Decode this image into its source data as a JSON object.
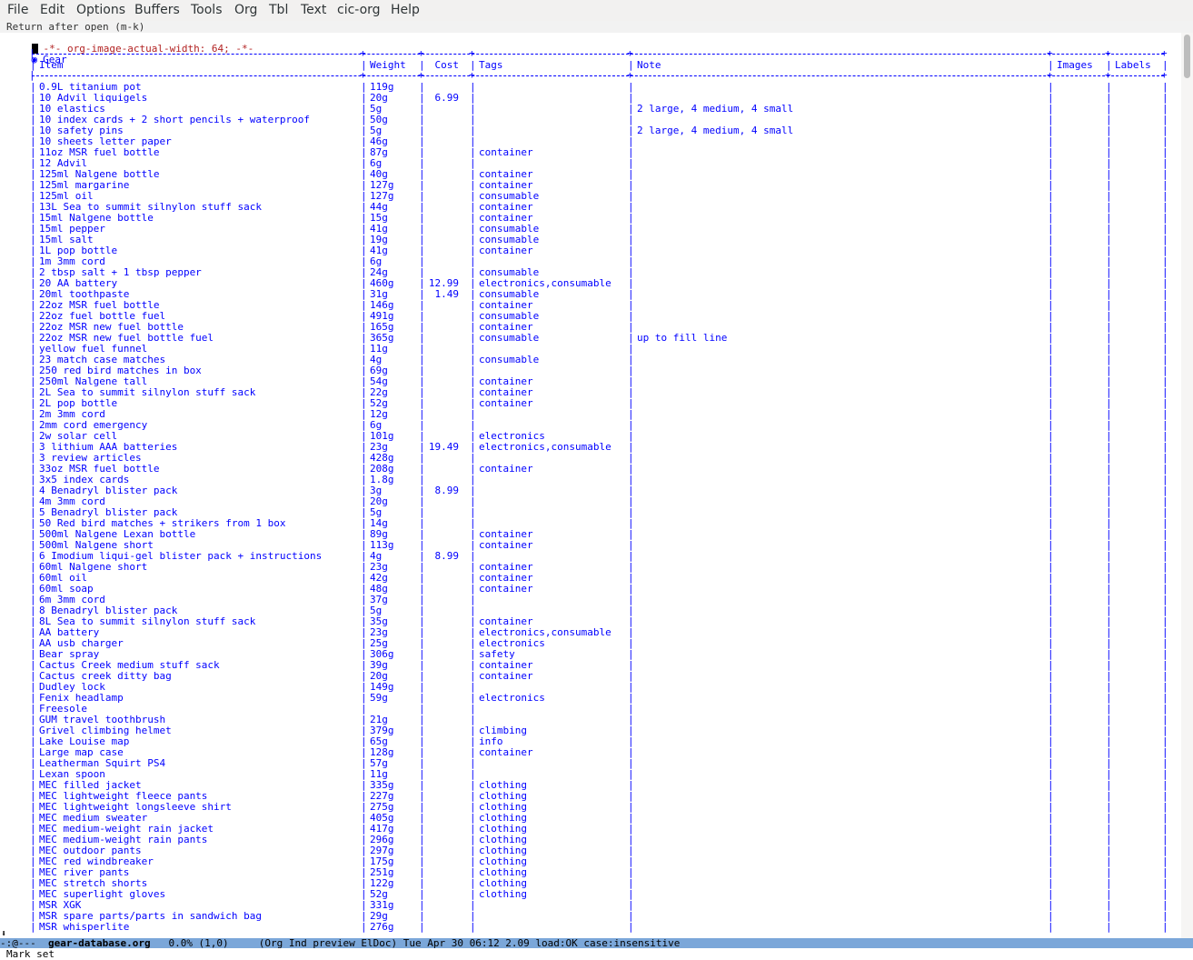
{
  "menu": [
    "File",
    "Edit",
    "Options",
    "Buffers",
    "Tools",
    "Org",
    "Tbl",
    "Text",
    "cic-org",
    "Help"
  ],
  "header_line": "Return after open (m-k)",
  "property_line": "-*- org-image-actual-width: 64; -*-",
  "heading": {
    "bullet": "◉",
    "title": "Gear"
  },
  "table": {
    "headers": [
      "Item",
      "Weight",
      "Cost",
      "Tags",
      "Note",
      "Images",
      "Labels"
    ],
    "rows": [
      [
        "0.9L titanium pot",
        "119g",
        "",
        "",
        "",
        "",
        ""
      ],
      [
        "10 Advil liquigels",
        "20g",
        "6.99",
        "",
        "",
        "",
        ""
      ],
      [
        "10 elastics",
        "5g",
        "",
        "",
        "2 large, 4 medium, 4 small",
        "",
        ""
      ],
      [
        "10 index cards + 2 short pencils + waterproof",
        "50g",
        "",
        "",
        "",
        "",
        ""
      ],
      [
        "10 safety pins",
        "5g",
        "",
        "",
        "2 large, 4 medium, 4 small",
        "",
        ""
      ],
      [
        "10 sheets letter paper",
        "46g",
        "",
        "",
        "",
        "",
        ""
      ],
      [
        "11oz MSR fuel bottle",
        "87g",
        "",
        "container",
        "",
        "",
        ""
      ],
      [
        "12 Advil",
        "6g",
        "",
        "",
        "",
        "",
        ""
      ],
      [
        "125ml Nalgene bottle",
        "40g",
        "",
        "container",
        "",
        "",
        ""
      ],
      [
        "125ml margarine",
        "127g",
        "",
        "container",
        "",
        "",
        ""
      ],
      [
        "125ml oil",
        "127g",
        "",
        "consumable",
        "",
        "",
        ""
      ],
      [
        "13L Sea to summit silnylon stuff sack",
        "44g",
        "",
        "container",
        "",
        "",
        ""
      ],
      [
        "15ml Nalgene bottle",
        "15g",
        "",
        "container",
        "",
        "",
        ""
      ],
      [
        "15ml pepper",
        "41g",
        "",
        "consumable",
        "",
        "",
        ""
      ],
      [
        "15ml salt",
        "19g",
        "",
        "consumable",
        "",
        "",
        ""
      ],
      [
        "1L pop bottle",
        "41g",
        "",
        "container",
        "",
        "",
        ""
      ],
      [
        "1m 3mm cord",
        "6g",
        "",
        "",
        "",
        "",
        ""
      ],
      [
        "2 tbsp salt + 1 tbsp pepper",
        "24g",
        "",
        "consumable",
        "",
        "",
        ""
      ],
      [
        "20 AA battery",
        "460g",
        "12.99",
        "electronics,consumable",
        "",
        "",
        ""
      ],
      [
        "20ml toothpaste",
        "31g",
        "1.49",
        "consumable",
        "",
        "",
        ""
      ],
      [
        "22oz MSR fuel bottle",
        "146g",
        "",
        "container",
        "",
        "",
        ""
      ],
      [
        "22oz fuel bottle fuel",
        "491g",
        "",
        "consumable",
        "",
        "",
        ""
      ],
      [
        "22oz MSR new fuel bottle",
        "165g",
        "",
        "container",
        "",
        "",
        ""
      ],
      [
        "22oz MSR new fuel bottle fuel",
        "365g",
        "",
        "consumable",
        "up to fill line",
        "",
        ""
      ],
      [
        "yellow fuel funnel",
        "11g",
        "",
        "",
        "",
        "",
        ""
      ],
      [
        "23 match case matches",
        "4g",
        "",
        "consumable",
        "",
        "",
        ""
      ],
      [
        "250 red bird matches in box",
        "69g",
        "",
        "",
        "",
        "",
        ""
      ],
      [
        "250ml Nalgene tall",
        "54g",
        "",
        "container",
        "",
        "",
        ""
      ],
      [
        "2L Sea to summit silnylon stuff sack",
        "22g",
        "",
        "container",
        "",
        "",
        ""
      ],
      [
        "2L pop bottle",
        "52g",
        "",
        "container",
        "",
        "",
        ""
      ],
      [
        "2m 3mm cord",
        "12g",
        "",
        "",
        "",
        "",
        ""
      ],
      [
        "2mm cord emergency",
        "6g",
        "",
        "",
        "",
        "",
        ""
      ],
      [
        "2w solar cell",
        "101g",
        "",
        "electronics",
        "",
        "",
        ""
      ],
      [
        "3 lithium AAA batteries",
        "23g",
        "19.49",
        "electronics,consumable",
        "",
        "",
        ""
      ],
      [
        "3 review articles",
        "428g",
        "",
        "",
        "",
        "",
        ""
      ],
      [
        "33oz MSR fuel bottle",
        "208g",
        "",
        "container",
        "",
        "",
        ""
      ],
      [
        "3x5 index cards",
        "1.8g",
        "",
        "",
        "",
        "",
        ""
      ],
      [
        "4 Benadryl blister pack",
        "3g",
        "8.99",
        "",
        "",
        "",
        ""
      ],
      [
        "4m 3mm cord",
        "20g",
        "",
        "",
        "",
        "",
        ""
      ],
      [
        "5 Benadryl blister pack",
        "5g",
        "",
        "",
        "",
        "",
        ""
      ],
      [
        "50 Red bird matches + strikers from 1 box",
        "14g",
        "",
        "",
        "",
        "",
        ""
      ],
      [
        "500ml Nalgene Lexan bottle",
        "89g",
        "",
        "container",
        "",
        "",
        ""
      ],
      [
        "500ml Nalgene short",
        "113g",
        "",
        "container",
        "",
        "",
        ""
      ],
      [
        "6 Imodium liqui-gel blister pack + instructions",
        "4g",
        "8.99",
        "",
        "",
        "",
        ""
      ],
      [
        "60ml Nalgene short",
        "23g",
        "",
        "container",
        "",
        "",
        ""
      ],
      [
        "60ml oil",
        "42g",
        "",
        "container",
        "",
        "",
        ""
      ],
      [
        "60ml soap",
        "48g",
        "",
        "container",
        "",
        "",
        ""
      ],
      [
        "6m 3mm cord",
        "37g",
        "",
        "",
        "",
        "",
        ""
      ],
      [
        "8 Benadryl blister pack",
        "5g",
        "",
        "",
        "",
        "",
        ""
      ],
      [
        "8L Sea to summit silnylon stuff sack",
        "35g",
        "",
        "container",
        "",
        "",
        ""
      ],
      [
        "AA battery",
        "23g",
        "",
        "electronics,consumable",
        "",
        "",
        ""
      ],
      [
        "AA usb charger",
        "25g",
        "",
        "electronics",
        "",
        "",
        ""
      ],
      [
        "Bear spray",
        "306g",
        "",
        "safety",
        "",
        "",
        ""
      ],
      [
        "Cactus Creek medium stuff sack",
        "39g",
        "",
        "container",
        "",
        "",
        ""
      ],
      [
        "Cactus creek ditty bag",
        "20g",
        "",
        "container",
        "",
        "",
        ""
      ],
      [
        "Dudley lock",
        "149g",
        "",
        "",
        "",
        "",
        ""
      ],
      [
        "Fenix headlamp",
        "59g",
        "",
        "electronics",
        "",
        "",
        ""
      ],
      [
        "Freesole",
        "",
        "",
        "",
        "",
        "",
        ""
      ],
      [
        "GUM travel toothbrush",
        "21g",
        "",
        "",
        "",
        "",
        ""
      ],
      [
        "Grivel climbing helmet",
        "379g",
        "",
        "climbing",
        "",
        "",
        ""
      ],
      [
        "Lake Louise map",
        "65g",
        "",
        "info",
        "",
        "",
        ""
      ],
      [
        "Large map case",
        "128g",
        "",
        "container",
        "",
        "",
        ""
      ],
      [
        "Leatherman Squirt PS4",
        "57g",
        "",
        "",
        "",
        "",
        ""
      ],
      [
        "Lexan spoon",
        "11g",
        "",
        "",
        "",
        "",
        ""
      ],
      [
        "MEC filled jacket",
        "335g",
        "",
        "clothing",
        "",
        "",
        ""
      ],
      [
        "MEC lightweight fleece pants",
        "227g",
        "",
        "clothing",
        "",
        "",
        ""
      ],
      [
        "MEC lightweight longsleeve shirt",
        "275g",
        "",
        "clothing",
        "",
        "",
        ""
      ],
      [
        "MEC medium sweater",
        "405g",
        "",
        "clothing",
        "",
        "",
        ""
      ],
      [
        "MEC medium-weight rain jacket",
        "417g",
        "",
        "clothing",
        "",
        "",
        ""
      ],
      [
        "MEC medium-weight rain pants",
        "296g",
        "",
        "clothing",
        "",
        "",
        ""
      ],
      [
        "MEC outdoor pants",
        "297g",
        "",
        "clothing",
        "",
        "",
        ""
      ],
      [
        "MEC red windbreaker",
        "175g",
        "",
        "clothing",
        "",
        "",
        ""
      ],
      [
        "MEC river pants",
        "251g",
        "",
        "clothing",
        "",
        "",
        ""
      ],
      [
        "MEC stretch shorts",
        "122g",
        "",
        "clothing",
        "",
        "",
        ""
      ],
      [
        "MEC superlight gloves",
        "52g",
        "",
        "clothing",
        "",
        "",
        ""
      ],
      [
        "MSR XGK",
        "331g",
        "",
        "",
        "",
        "",
        ""
      ],
      [
        "MSR spare parts/parts in sandwich bag",
        "29g",
        "",
        "",
        "",
        "",
        ""
      ],
      [
        "MSR whisperlite",
        "276g",
        "",
        "",
        "",
        "",
        ""
      ]
    ]
  },
  "modeline": {
    "status": "-:@---  ",
    "buffer": "gear-database.org",
    "position": "   0.0% (1,0)",
    "modes": "     (Org Ind preview ElDoc) Tue Apr 30 06:12 2.09 load:OK case:insensitive"
  },
  "echo": "Mark set",
  "colors": {
    "text": "#0000ff",
    "property": "#b22222",
    "modeline": "#7ba7d9"
  }
}
